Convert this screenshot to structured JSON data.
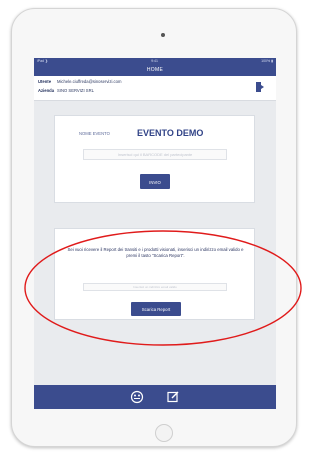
{
  "status": {
    "left": "iPad ❯",
    "center": "9:41",
    "right": "100% ▮"
  },
  "nav": {
    "title": "HOME"
  },
  "user": {
    "label": "Utente",
    "value": "Michele.ciuffreda@sinoservizi.com"
  },
  "company": {
    "label": "Azienda",
    "value": "SINO SERVIZI SRL"
  },
  "event": {
    "label": "NOME EVENTO",
    "name": "EVENTO DEMO",
    "barcode_placeholder": "Inserisci qui il BARCODE del partecipante",
    "submit_label": "INVIO"
  },
  "report": {
    "message": "Sei vuoi ricevere il Report dei transiti e i prodotti visionati, inserisci un indirizzo email valido e premi il tasto \"Scarica Report\".",
    "email_placeholder": "Inserisci un indirizzo email valido",
    "button_label": "Scarica Report"
  },
  "tabs": [
    {
      "icon": "palette-icon"
    },
    {
      "icon": "edit-icon"
    }
  ],
  "colors": {
    "primary": "#3b4c8e",
    "annotation": "#e01b1b"
  }
}
